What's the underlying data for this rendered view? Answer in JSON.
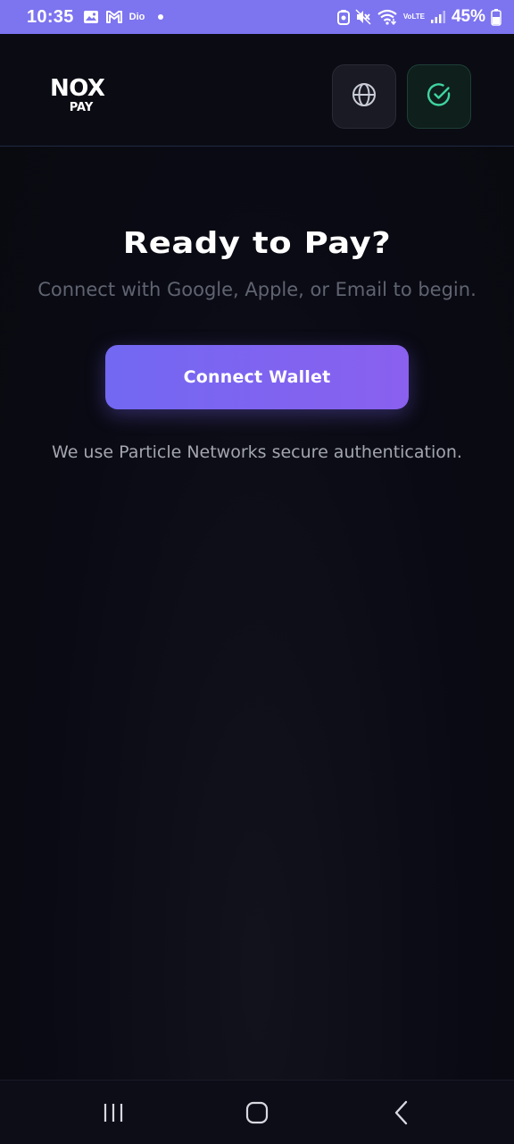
{
  "status_bar": {
    "time": "10:35",
    "carrier_label": "Dio",
    "volte_top": "Vo",
    "volte_bottom": "LTE",
    "battery": "45%",
    "icons": [
      "gallery-icon",
      "gmail-icon",
      "dio-icon",
      "notification-dot",
      "cast-icon",
      "mute-icon",
      "wifi-icon",
      "volte-icon",
      "signal-icon",
      "battery-icon"
    ]
  },
  "header": {
    "logo_title": "NOX",
    "logo_subtitle": "PAY",
    "language_icon": "globe-icon",
    "status_icon": "check-circle-icon"
  },
  "main": {
    "title": "Ready to Pay?",
    "subtitle": "Connect with Google, Apple, or Email to begin.",
    "connect_button": "Connect Wallet",
    "note": "We use Particle Networks secure authentication."
  },
  "nav_bar": {
    "icons": [
      "recent-apps-icon",
      "home-icon",
      "back-icon"
    ]
  },
  "colors": {
    "status_bar": "#7d74f0",
    "background": "#0a0a14",
    "button_start": "#7268f2",
    "button_end": "#8a60ef",
    "success": "#3fd4a0"
  }
}
